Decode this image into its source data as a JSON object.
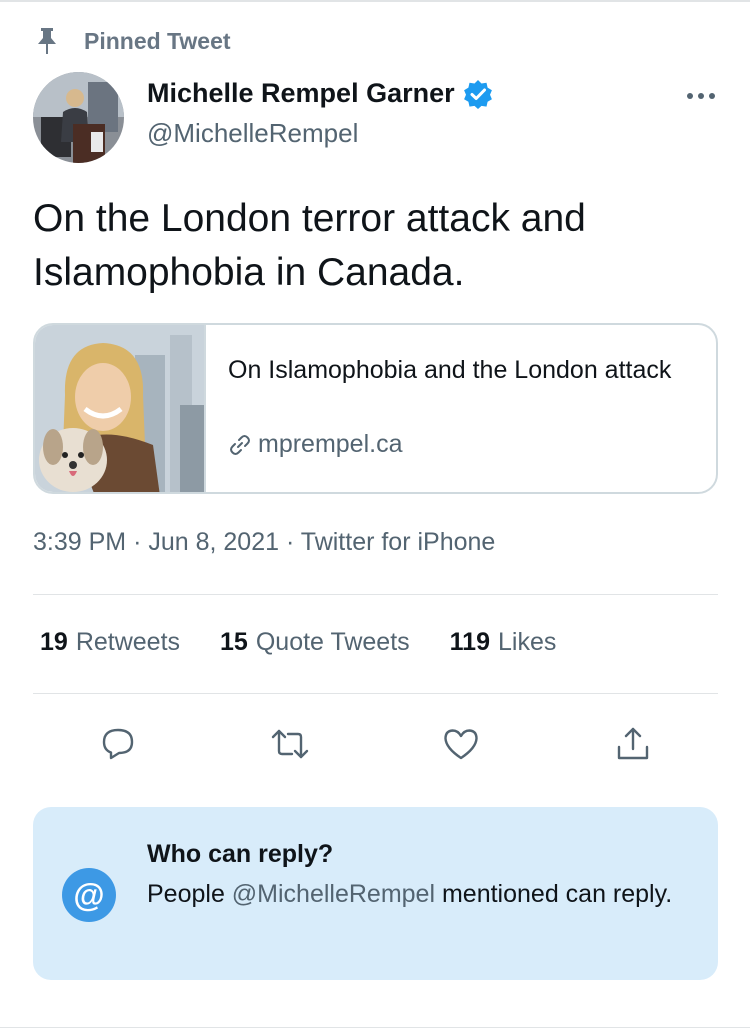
{
  "pinned": {
    "label": "Pinned Tweet",
    "icon": "pin-icon"
  },
  "author": {
    "name": "Michelle Rempel Garner",
    "handle": "@MichelleRempel",
    "verified_icon": "verified-badge-icon"
  },
  "tweet": {
    "text": "On the London terror attack and Islamophobia in Canada."
  },
  "link_card": {
    "title": "On Islamophobia and the London attack",
    "domain": "mprempel.ca",
    "icon": "link-icon"
  },
  "meta": {
    "time": "3:39 PM",
    "date": "Jun 8, 2021",
    "source": "Twitter for iPhone",
    "separator": "·"
  },
  "stats": [
    {
      "count": "19",
      "label": "Retweets"
    },
    {
      "count": "15",
      "label": "Quote Tweets"
    },
    {
      "count": "119",
      "label": "Likes"
    }
  ],
  "actions": [
    "reply-icon",
    "retweet-icon",
    "like-icon",
    "share-icon"
  ],
  "reply_settings": {
    "title": "Who can reply?",
    "body_before": "People ",
    "mention": "@MichelleRempel",
    "body_after": " mentioned can reply.",
    "icon": "at-icon"
  },
  "colors": {
    "accent": "#1d9bf0",
    "secondary_text": "#536471",
    "reply_box_bg": "#d8ecfa",
    "at_icon_bg": "#3d99e5"
  }
}
